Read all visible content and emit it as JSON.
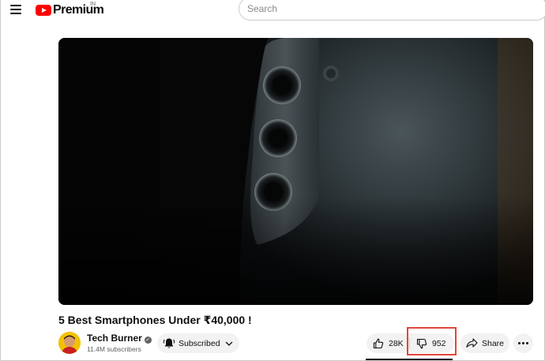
{
  "header": {
    "menu_icon": "hamburger-menu-icon",
    "logo_text": "Premium",
    "country_code": "IN",
    "search_placeholder": "Search",
    "brand_color": "#ff0000"
  },
  "video": {
    "title": "5 Best Smartphones Under ₹40,000 !",
    "thumbnail_subject": "camera-module-image"
  },
  "channel": {
    "name": "Tech Burner",
    "verified_icon": "verified-check-icon",
    "subscribers": "11.4M subscribers"
  },
  "actions": {
    "subscribe_label": "Subscribed",
    "like_count": "28K",
    "dislike_count": "952",
    "share_label": "Share",
    "highlight_color": "#e0473a"
  }
}
